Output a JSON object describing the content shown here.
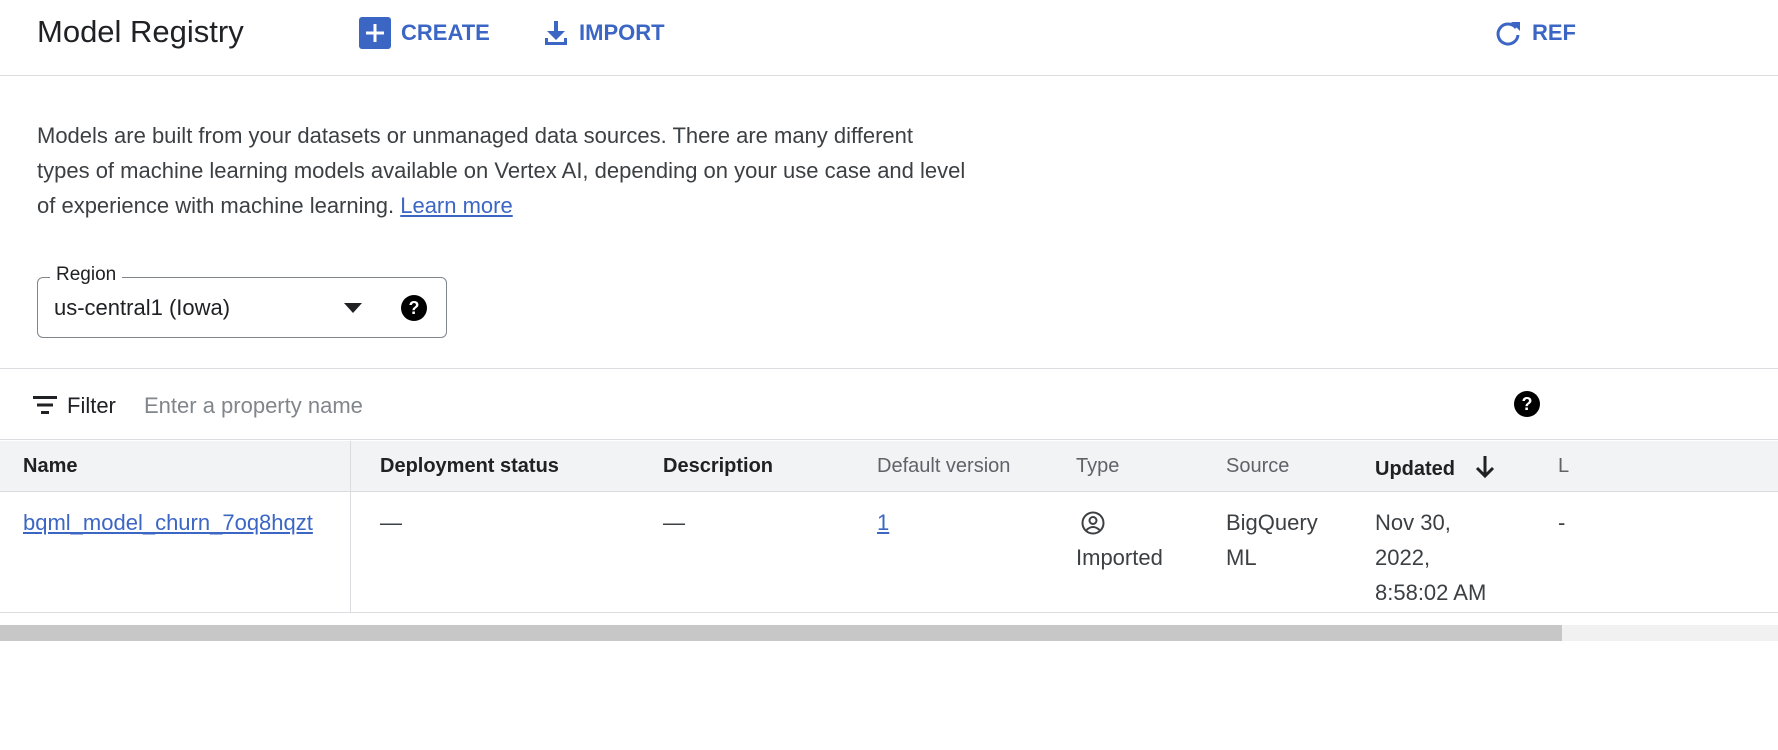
{
  "header": {
    "title": "Model Registry",
    "create_label": "CREATE",
    "import_label": "IMPORT",
    "refresh_label": "REF"
  },
  "intro": {
    "text": "Models are built from your datasets or unmanaged data sources. There are many different types of machine learning models available on Vertex AI, depending on your use case and level of experience with machine learning.",
    "learn_more": "Learn more"
  },
  "region": {
    "label": "Region",
    "value": "us-central1 (Iowa)"
  },
  "filter": {
    "label": "Filter",
    "placeholder": "Enter a property name"
  },
  "table": {
    "columns": {
      "name": "Name",
      "deployment_status": "Deployment status",
      "description": "Description",
      "default_version": "Default version",
      "type": "Type",
      "source": "Source",
      "updated": "Updated",
      "last_col": "L"
    },
    "rows": [
      {
        "name": "bqml_model_churn_7oq8hqzt",
        "deployment_status": "—",
        "description": "—",
        "default_version": "1",
        "type": "Imported",
        "source": "BigQuery ML",
        "updated": "Nov 30, 2022, 8:58:02 AM",
        "last_col": "-"
      }
    ]
  },
  "icons": {
    "create": "add-box-icon",
    "import": "download-icon",
    "refresh": "refresh-icon",
    "region_dropdown": "arrow-drop-down-icon",
    "help": "help-icon",
    "filter": "filter-list-icon",
    "sort": "arrow-down-icon",
    "type": "account-circle-icon"
  },
  "colors": {
    "accent": "#3c66c4",
    "text": "#202124",
    "muted": "#5f6368",
    "border": "#dadce0"
  }
}
